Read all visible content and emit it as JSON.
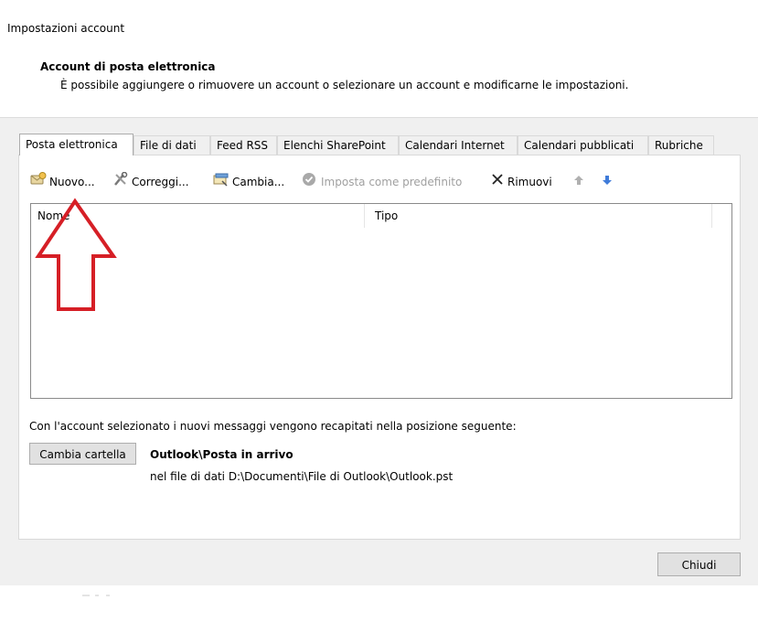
{
  "dialog": {
    "title": "Impostazioni account",
    "section_title": "Account di posta elettronica",
    "section_description": "È possibile aggiungere o rimuovere un account o selezionare un account e modificarne le impostazioni."
  },
  "tabs": [
    {
      "label": "Posta elettronica",
      "active": true
    },
    {
      "label": "File di dati"
    },
    {
      "label": "Feed RSS"
    },
    {
      "label": "Elenchi SharePoint"
    },
    {
      "label": "Calendari Internet"
    },
    {
      "label": "Calendari pubblicati"
    },
    {
      "label": "Rubriche"
    }
  ],
  "toolbar": {
    "new_label": "Nuovo...",
    "new_icon": "new-mail-account-icon",
    "repair_label": "Correggi...",
    "repair_icon": "repair-tools-icon",
    "change_label": "Cambia...",
    "change_icon": "change-account-icon",
    "set_default_label": "Imposta come predefinito",
    "set_default_icon": "check-circle-icon",
    "remove_label": "Rimuovi",
    "remove_icon": "x-icon",
    "move_up_icon": "arrow-up-icon",
    "move_down_icon": "arrow-down-icon"
  },
  "accounts_list": {
    "columns": [
      "Nome",
      "Tipo"
    ],
    "rows": []
  },
  "annotation": {
    "type": "arrow-up",
    "color": "#d61f26"
  },
  "delivery": {
    "info_text": "Con l'account selezionato i nuovi messaggi vengono recapitati nella posizione seguente:",
    "change_folder_label": "Cambia cartella",
    "folder_path": "Outlook\\Posta in arrivo",
    "data_file_text": "nel file di dati D:\\Documenti\\File di Outlook\\Outlook.pst"
  },
  "footer": {
    "close_label": "Chiudi"
  },
  "colors": {
    "dialog_bg": "#f0f0f0",
    "panel_bg": "#ffffff",
    "annotation_red": "#d61f26",
    "arrow_blue": "#3f7bd9"
  }
}
